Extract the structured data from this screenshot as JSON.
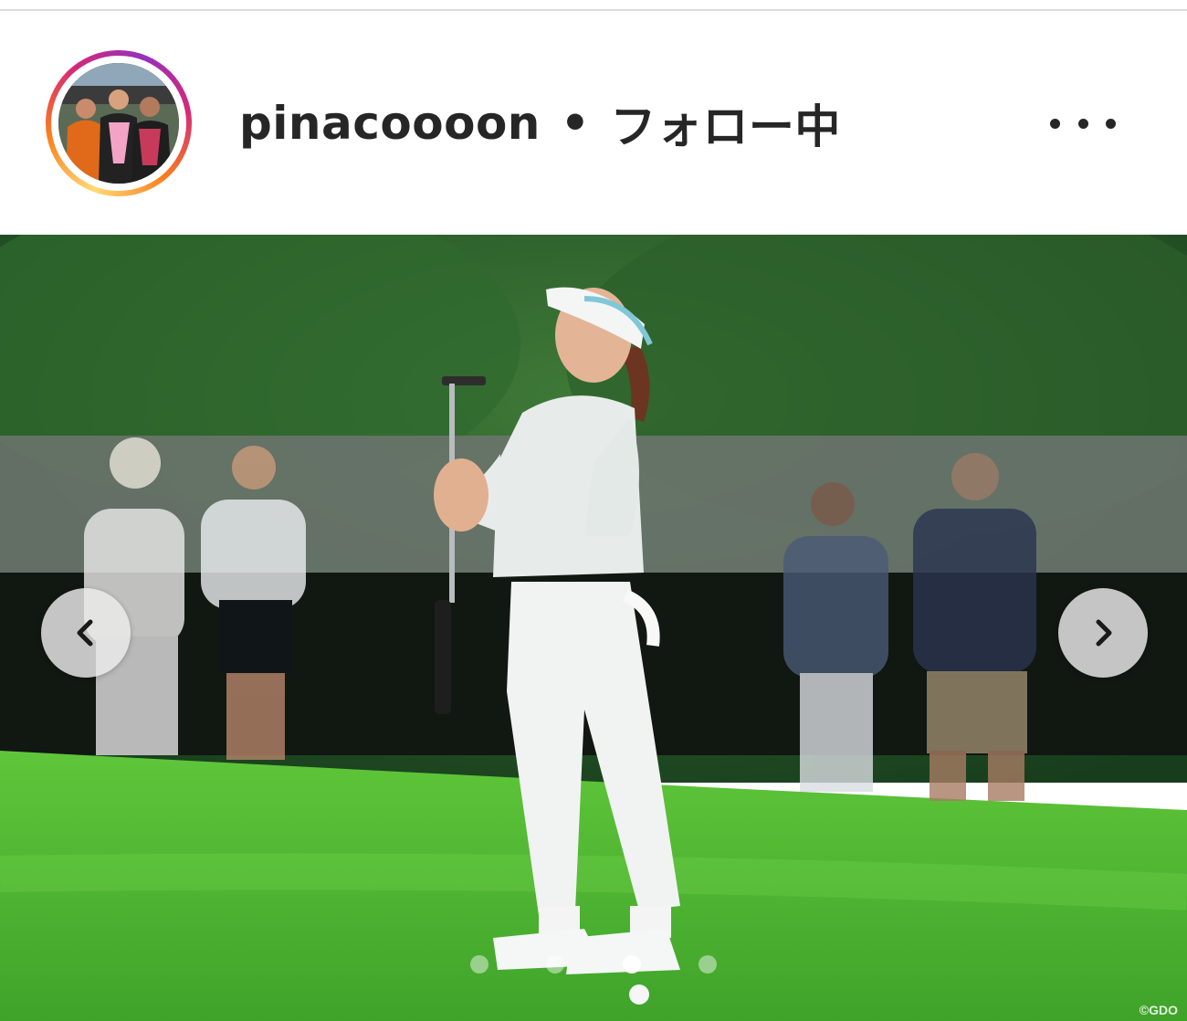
{
  "post_header": {
    "username": "pinacoooon",
    "separator": "•",
    "follow_state": "フォロー中",
    "more_icon": "more-horizontal-icon"
  },
  "photo": {
    "watermark": "©GDO",
    "carousel": {
      "prev_icon": "chevron-left-icon",
      "next_icon": "chevron-right-icon",
      "slide_count": 4,
      "active_slide": 3
    }
  }
}
